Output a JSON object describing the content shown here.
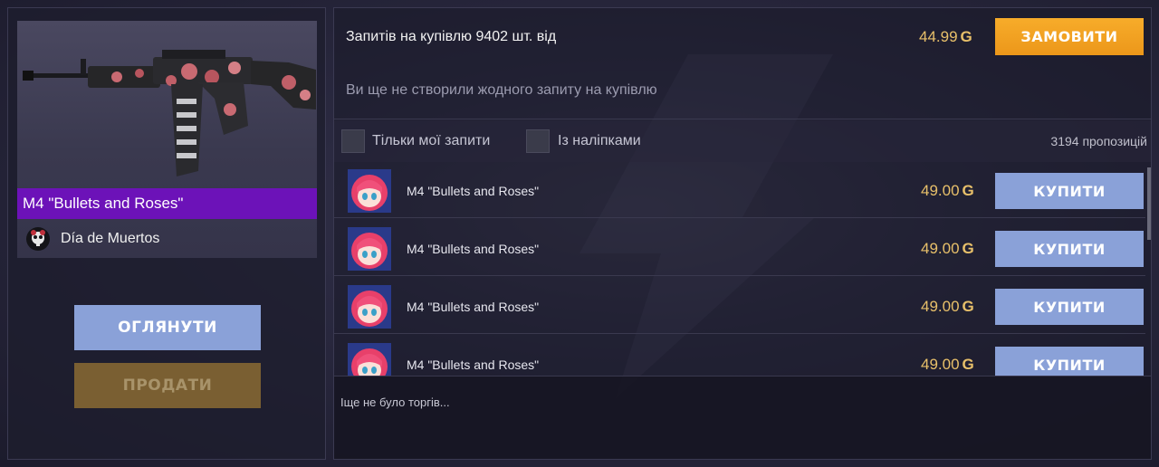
{
  "item": {
    "name": "M4 \"Bullets and Roses\"",
    "rarity_color": "#6c12b8",
    "sticker_icon": "skull-sticker-icon",
    "sticker_name": "Día de Muertos"
  },
  "actions": {
    "inspect_label": "ОГЛЯНУТИ",
    "sell_label": "ПРОДАТИ"
  },
  "buy_orders": {
    "summary": "Запитів на купівлю 9402 шт. від",
    "price": "44.99",
    "currency_symbol": "G",
    "order_button": "ЗАМОВИТИ",
    "empty_message": "Ви ще не створили жодного запиту на купівлю"
  },
  "filters": {
    "my_requests_label": "Тільки мої запити",
    "my_requests_checked": false,
    "with_stickers_label": "Із наліпками",
    "with_stickers_checked": false,
    "offers_count": "3194 пропозицій"
  },
  "listings": [
    {
      "name": "M4 \"Bullets and Roses\"",
      "price": "49.00",
      "currency_symbol": "G",
      "button": "КУПИТИ",
      "avatar": "anime-girl-avatar-icon"
    },
    {
      "name": "M4 \"Bullets and Roses\"",
      "price": "49.00",
      "currency_symbol": "G",
      "button": "КУПИТИ",
      "avatar": "anime-girl-avatar-icon"
    },
    {
      "name": "M4 \"Bullets and Roses\"",
      "price": "49.00",
      "currency_symbol": "G",
      "button": "КУПИТИ",
      "avatar": "anime-girl-avatar-icon"
    },
    {
      "name": "M4 \"Bullets and Roses\"",
      "price": "49.00",
      "currency_symbol": "G",
      "button": "КУПИТИ",
      "avatar": "anime-girl-avatar-icon"
    }
  ],
  "trades": {
    "empty_message": "Іще не було торгів..."
  },
  "colors": {
    "accent_orange": "#f7ac2a",
    "button_blue": "#8aa1d8",
    "price_gold": "#e8c06a",
    "sell_disabled": "#7a5f32"
  }
}
